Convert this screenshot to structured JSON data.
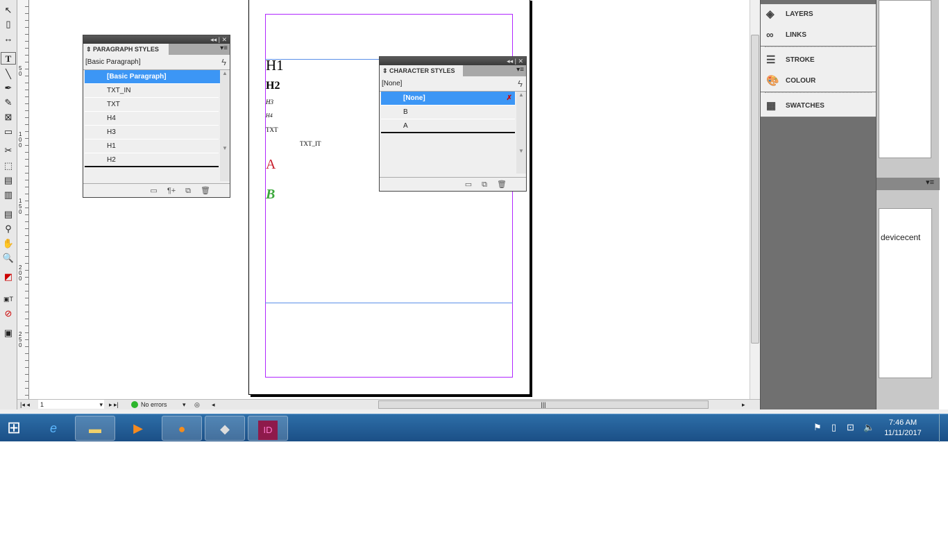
{
  "app": {
    "name": "InDesign"
  },
  "paragraph_styles": {
    "title": "PARAGRAPH STYLES",
    "current": "[Basic Paragraph]",
    "items": [
      "[Basic Paragraph]",
      "TXT_IN",
      "TXT",
      "H4",
      "H3",
      "H1",
      "H2"
    ],
    "selected": "[Basic Paragraph]"
  },
  "character_styles": {
    "title": "CHARACTER STYLES",
    "current": "[None]",
    "items": [
      "[None]",
      "B",
      "A"
    ],
    "selected": "[None]"
  },
  "document": {
    "texts": {
      "h1": "H1",
      "h2": "H2",
      "h3": "H3",
      "h4": "H4",
      "txt": "TXT",
      "txt_it": "TXT_IT",
      "a": "A",
      "b": "B"
    },
    "colors": {
      "a": "#c8202e",
      "b": "#3aa83a",
      "margin": "#b026ff",
      "guide": "#5a8fe8"
    }
  },
  "ruler": {
    "labels": [
      "5 0",
      "1 0 0",
      "1 5 0",
      "2 0 0",
      "2 5 0"
    ]
  },
  "dock": {
    "items": [
      {
        "label": "LAYERS",
        "icon": "layers-icon"
      },
      {
        "label": "LINKS",
        "icon": "links-icon"
      },
      {
        "label": "STROKE",
        "icon": "stroke-icon"
      },
      {
        "label": "COLOUR",
        "icon": "colour-icon"
      },
      {
        "label": "SWATCHES",
        "icon": "swatches-icon"
      }
    ]
  },
  "behind_window": {
    "text": "devicecent"
  },
  "status": {
    "page": "1",
    "preflight": "No errors"
  },
  "taskbar": {
    "time": "7:46 AM",
    "date": "11/11/2017",
    "apps": [
      "internet-explorer",
      "file-explorer",
      "media-player",
      "firefox",
      "app-5",
      "indesign"
    ]
  }
}
